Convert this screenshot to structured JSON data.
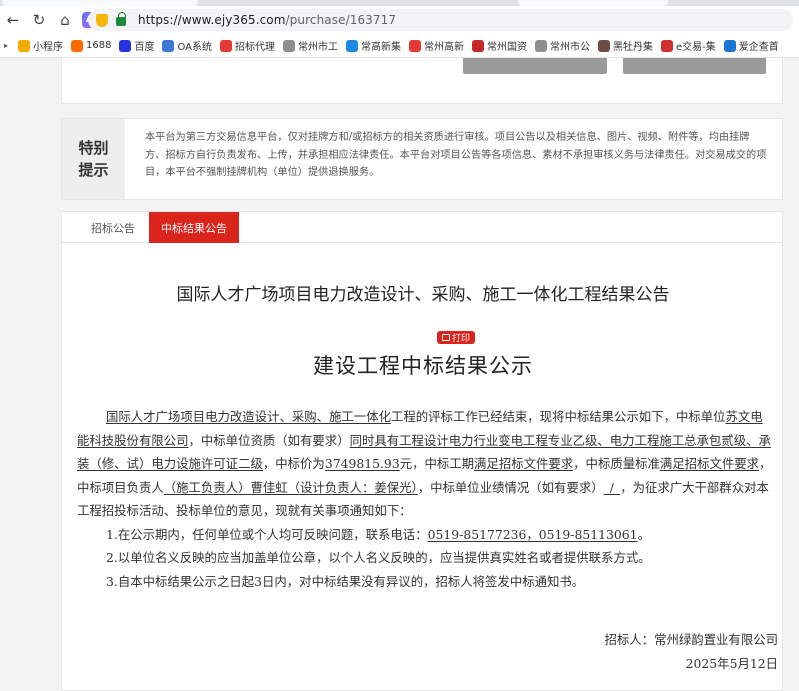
{
  "browser": {
    "url_host": "https://www.ejy365.com",
    "url_path": "/purchase/163717",
    "ai_label": "AI",
    "bookmarks": [
      {
        "label": "小程序",
        "color": "#f2a900"
      },
      {
        "label": "1688",
        "color": "#ff6a00"
      },
      {
        "label": "百度",
        "color": "#2932e1"
      },
      {
        "label": "OA系统",
        "color": "#3a7bd5"
      },
      {
        "label": "招标代理",
        "color": "#e53935"
      },
      {
        "label": "常州市工",
        "color": "#8e8e8e"
      },
      {
        "label": "常高新集",
        "color": "#1e88e5"
      },
      {
        "label": "常州高新",
        "color": "#e53935"
      },
      {
        "label": "常州国资",
        "color": "#c62828"
      },
      {
        "label": "常州市公",
        "color": "#8e8e8e"
      },
      {
        "label": "黑牡丹集",
        "color": "#6d4c41"
      },
      {
        "label": "e交易-集",
        "color": "#d32f2f"
      },
      {
        "label": "爱企查首",
        "color": "#1976d2"
      }
    ]
  },
  "notice": {
    "heading_line1": "特别",
    "heading_line2": "提示",
    "text": "本平台为第三方交易信息平台，仅对挂牌方和/或招标方的相关资质进行审核。项目公告以及相关信息、图片、视频、附件等，均由挂牌方、招标方自行负责发布、上传，并承担相应法律责任。本平台对项目公告等各项信息、素材不承担审核义务与法律责任。对交易成交的项目，本平台不强制挂牌机构（单位）提供退换服务。"
  },
  "tabs": {
    "bid_notice": "招标公告",
    "award_notice": "中标结果公告"
  },
  "document": {
    "title": "国际人才广场项目电力改造设计、采购、施工一体化工程结果公告",
    "print_label": "打印",
    "subtitle": "建设工程中标结果公示",
    "project_name": "国际人才广场项目电力改造设计、采购、施工一体化",
    "t1": "工程的评标工作已经结束，现将中标结果公示如下，中标单位",
    "winner": "苏文电能科技股份有限公司",
    "t2": "，中标单位资质（如有要求）",
    "qualification": "同时具有工程设计电力行业变电工程专业乙级、电力工程施工总承包贰级、承装（修、试）电力设施许可证二级",
    "t3": "，中标价为",
    "price": "3749815.93",
    "t4": "元，中标工期",
    "period": "满足招标文件要求",
    "t5": "，中标质量标准",
    "quality": "满足招标文件要求",
    "t6": "，中标项目负责人",
    "manager": "（施工负责人）曹佳虹（设计负责人：姜保光）",
    "t7": "，中标单位业绩情况（如有要求）",
    "performance": "_/_",
    "t8": "，为征求广大干部群众对本工程招投标活动、投标单位的意见，现就有关事项通知如下：",
    "item1_a": "1.在公示期内，任何单位或个人均可反映问题，联系电话：",
    "item1_phone": "0519-85177236，0519-85113061",
    "item1_b": "。",
    "item2": "2.以单位名义反映的应当加盖单位公章，以个人名义反映的，应当提供真实姓名或者提供联系方式。",
    "item3": "3.自本中标结果公示之日起3日内，对中标结果没有异议的，招标人将签发中标通知书。",
    "signer": "招标人：常州绿韵置业有限公司",
    "date": "2025年5月12日"
  }
}
